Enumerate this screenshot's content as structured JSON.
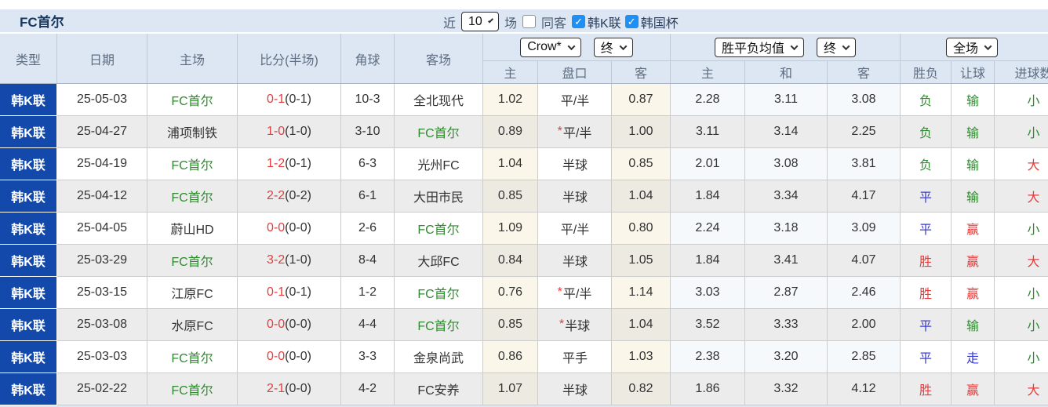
{
  "title": "FC首尔",
  "icons": {
    "checkmark": "✓"
  },
  "colors": {
    "type_badge_bg": "#1449ac",
    "header_bg": "#dce7f3",
    "win_red": "#e63c3c",
    "draw_blue": "#3b3bd6",
    "loss_green": "#2e8b2e",
    "checkbox_blue": "#1e90f5"
  },
  "controls": {
    "recent_label": "近",
    "recent_value": "10",
    "matches_label": "场",
    "same_away_label": "同客",
    "league_label": "韩K联",
    "cup_label": "韩国杯"
  },
  "header": {
    "col_type": "类型",
    "col_date": "日期",
    "col_home": "主场",
    "col_score": "比分(半场)",
    "col_corner": "角球",
    "col_away": "客场",
    "odds_source": "Crow*",
    "odds_time": "终",
    "avg_label": "胜平负均值",
    "avg_time": "终",
    "scope_label": "全场",
    "sub_odds_home": "主",
    "sub_handicap": "盘口",
    "sub_odds_away": "客",
    "sub_avg_home": "主",
    "sub_avg_draw": "和",
    "sub_avg_away": "客",
    "sub_result": "胜负",
    "sub_let_ball": "让球",
    "sub_goals": "进球数"
  },
  "rows": [
    {
      "type": "韩K联",
      "date": "25-05-03",
      "home": "FC首尔",
      "home_color": "green",
      "score": "0-1",
      "half": "(0-1)",
      "corner": "10-3",
      "away": "全北现代",
      "away_color": "dark",
      "odds_home": "1.02",
      "handicap_star": "",
      "handicap": "平/半",
      "odds_away": "0.87",
      "avg_home": "2.28",
      "avg_draw": "3.11",
      "avg_away": "3.08",
      "result": "负",
      "result_color": "green",
      "let_ball": "输",
      "let_ball_color": "green",
      "goals": "小",
      "goals_color": "green"
    },
    {
      "type": "韩K联",
      "date": "25-04-27",
      "home": "浦项制铁",
      "home_color": "dark",
      "score": "1-0",
      "half": "(1-0)",
      "corner": "3-10",
      "away": "FC首尔",
      "away_color": "green",
      "odds_home": "0.89",
      "handicap_star": "*",
      "handicap": "平/半",
      "odds_away": "1.00",
      "avg_home": "3.11",
      "avg_draw": "3.14",
      "avg_away": "2.25",
      "result": "负",
      "result_color": "green",
      "let_ball": "输",
      "let_ball_color": "green",
      "goals": "小",
      "goals_color": "green"
    },
    {
      "type": "韩K联",
      "date": "25-04-19",
      "home": "FC首尔",
      "home_color": "green",
      "score": "1-2",
      "half": "(0-1)",
      "corner": "6-3",
      "away": "光州FC",
      "away_color": "dark",
      "odds_home": "1.04",
      "handicap_star": "",
      "handicap": "半球",
      "odds_away": "0.85",
      "avg_home": "2.01",
      "avg_draw": "3.08",
      "avg_away": "3.81",
      "result": "负",
      "result_color": "green",
      "let_ball": "输",
      "let_ball_color": "green",
      "goals": "大",
      "goals_color": "red"
    },
    {
      "type": "韩K联",
      "date": "25-04-12",
      "home": "FC首尔",
      "home_color": "green",
      "score": "2-2",
      "half": "(0-2)",
      "corner": "6-1",
      "away": "大田市民",
      "away_color": "dark",
      "odds_home": "0.85",
      "handicap_star": "",
      "handicap": "半球",
      "odds_away": "1.04",
      "avg_home": "1.84",
      "avg_draw": "3.34",
      "avg_away": "4.17",
      "result": "平",
      "result_color": "blue",
      "let_ball": "输",
      "let_ball_color": "green",
      "goals": "大",
      "goals_color": "red"
    },
    {
      "type": "韩K联",
      "date": "25-04-05",
      "home": "蔚山HD",
      "home_color": "dark",
      "score": "0-0",
      "half": "(0-0)",
      "corner": "2-6",
      "away": "FC首尔",
      "away_color": "green",
      "odds_home": "1.09",
      "handicap_star": "",
      "handicap": "平/半",
      "odds_away": "0.80",
      "avg_home": "2.24",
      "avg_draw": "3.18",
      "avg_away": "3.09",
      "result": "平",
      "result_color": "blue",
      "let_ball": "赢",
      "let_ball_color": "red",
      "goals": "小",
      "goals_color": "green"
    },
    {
      "type": "韩K联",
      "date": "25-03-29",
      "home": "FC首尔",
      "home_color": "green",
      "score": "3-2",
      "half": "(1-0)",
      "corner": "8-4",
      "away": "大邱FC",
      "away_color": "dark",
      "odds_home": "0.84",
      "handicap_star": "",
      "handicap": "半球",
      "odds_away": "1.05",
      "avg_home": "1.84",
      "avg_draw": "3.41",
      "avg_away": "4.07",
      "result": "胜",
      "result_color": "red",
      "let_ball": "赢",
      "let_ball_color": "red",
      "goals": "大",
      "goals_color": "red"
    },
    {
      "type": "韩K联",
      "date": "25-03-15",
      "home": "江原FC",
      "home_color": "dark",
      "score": "0-1",
      "half": "(0-1)",
      "corner": "1-2",
      "away": "FC首尔",
      "away_color": "green",
      "odds_home": "0.76",
      "handicap_star": "*",
      "handicap": "平/半",
      "odds_away": "1.14",
      "avg_home": "3.03",
      "avg_draw": "2.87",
      "avg_away": "2.46",
      "result": "胜",
      "result_color": "red",
      "let_ball": "赢",
      "let_ball_color": "red",
      "goals": "小",
      "goals_color": "green"
    },
    {
      "type": "韩K联",
      "date": "25-03-08",
      "home": "水原FC",
      "home_color": "dark",
      "score": "0-0",
      "half": "(0-0)",
      "corner": "4-4",
      "away": "FC首尔",
      "away_color": "green",
      "odds_home": "0.85",
      "handicap_star": "*",
      "handicap": "半球",
      "odds_away": "1.04",
      "avg_home": "3.52",
      "avg_draw": "3.33",
      "avg_away": "2.00",
      "result": "平",
      "result_color": "blue",
      "let_ball": "输",
      "let_ball_color": "green",
      "goals": "小",
      "goals_color": "green"
    },
    {
      "type": "韩K联",
      "date": "25-03-03",
      "home": "FC首尔",
      "home_color": "green",
      "score": "0-0",
      "half": "(0-0)",
      "corner": "3-3",
      "away": "金泉尚武",
      "away_color": "dark",
      "odds_home": "0.86",
      "handicap_star": "",
      "handicap": "平手",
      "odds_away": "1.03",
      "avg_home": "2.38",
      "avg_draw": "3.20",
      "avg_away": "2.85",
      "result": "平",
      "result_color": "blue",
      "let_ball": "走",
      "let_ball_color": "blue",
      "goals": "小",
      "goals_color": "green"
    },
    {
      "type": "韩K联",
      "date": "25-02-22",
      "home": "FC首尔",
      "home_color": "green",
      "score": "2-1",
      "half": "(0-0)",
      "corner": "4-2",
      "away": "FC安养",
      "away_color": "dark",
      "odds_home": "1.07",
      "handicap_star": "",
      "handicap": "半球",
      "odds_away": "0.82",
      "avg_home": "1.86",
      "avg_draw": "3.32",
      "avg_away": "4.12",
      "result": "胜",
      "result_color": "red",
      "let_ball": "赢",
      "let_ball_color": "red",
      "goals": "大",
      "goals_color": "red"
    }
  ]
}
